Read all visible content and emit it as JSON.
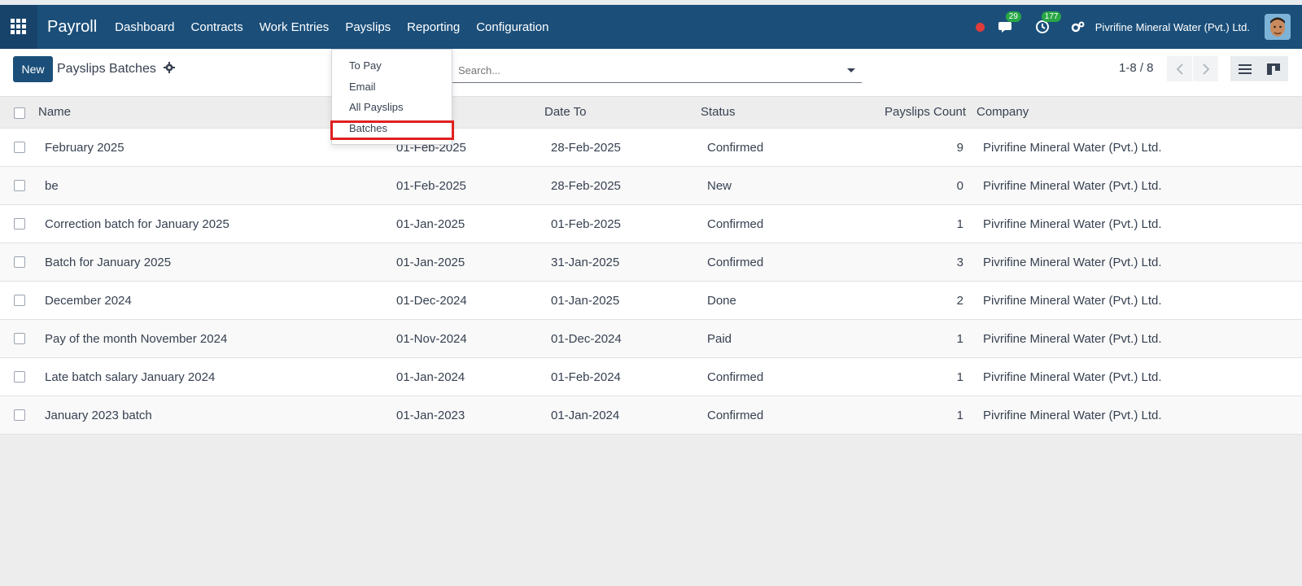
{
  "navbar": {
    "app_title": "Payroll",
    "menu": [
      "Dashboard",
      "Contracts",
      "Work Entries",
      "Payslips",
      "Reporting",
      "Configuration"
    ],
    "messages_badge": "29",
    "activities_badge": "177",
    "company": "Pivrifine Mineral Water (Pvt.) Ltd.",
    "brand_color": "#1b4f7a"
  },
  "control_panel": {
    "new_label": "New",
    "breadcrumb": "Payslips Batches",
    "search_placeholder": "Search...",
    "pager": "1-8 / 8"
  },
  "dropdown": {
    "items": [
      "To Pay",
      "Email",
      "All Payslips",
      "Batches"
    ],
    "highlighted": "Batches"
  },
  "columns": [
    "Name",
    "Date To",
    "Status",
    "Payslips Count",
    "Company"
  ],
  "rows": [
    {
      "name": "February 2025",
      "date_from": "01-Feb-2025",
      "date_to": "28-Feb-2025",
      "status": "Confirmed",
      "count": "9",
      "company": "Pivrifine Mineral Water (Pvt.) Ltd."
    },
    {
      "name": "be",
      "date_from": "01-Feb-2025",
      "date_to": "28-Feb-2025",
      "status": "New",
      "count": "0",
      "company": "Pivrifine Mineral Water (Pvt.) Ltd."
    },
    {
      "name": "Correction batch for January 2025",
      "date_from": "01-Jan-2025",
      "date_to": "01-Feb-2025",
      "status": "Confirmed",
      "count": "1",
      "company": "Pivrifine Mineral Water (Pvt.) Ltd."
    },
    {
      "name": "Batch for January 2025",
      "date_from": "01-Jan-2025",
      "date_to": "31-Jan-2025",
      "status": "Confirmed",
      "count": "3",
      "company": "Pivrifine Mineral Water (Pvt.) Ltd."
    },
    {
      "name": "December 2024",
      "date_from": "01-Dec-2024",
      "date_to": "01-Jan-2025",
      "status": "Done",
      "count": "2",
      "company": "Pivrifine Mineral Water (Pvt.) Ltd."
    },
    {
      "name": "Pay of the month November 2024",
      "date_from": "01-Nov-2024",
      "date_to": "01-Dec-2024",
      "status": "Paid",
      "count": "1",
      "company": "Pivrifine Mineral Water (Pvt.) Ltd."
    },
    {
      "name": "Late batch salary January 2024",
      "date_from": "01-Jan-2024",
      "date_to": "01-Feb-2024",
      "status": "Confirmed",
      "count": "1",
      "company": "Pivrifine Mineral Water (Pvt.) Ltd."
    },
    {
      "name": "January 2023 batch",
      "date_from": "01-Jan-2023",
      "date_to": "01-Jan-2024",
      "status": "Confirmed",
      "count": "1",
      "company": "Pivrifine Mineral Water (Pvt.) Ltd."
    }
  ]
}
